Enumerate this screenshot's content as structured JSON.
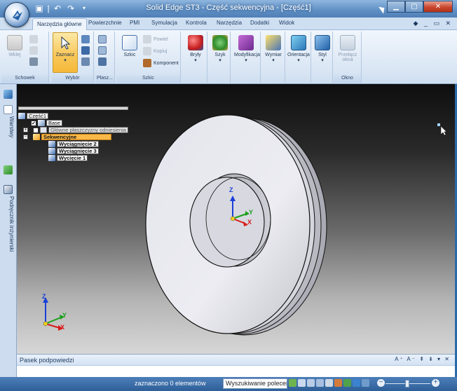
{
  "window": {
    "title": "Solid Edge ST3 - Część sekwencyjna - [Część1]"
  },
  "tabs": [
    {
      "label": "Narzędzia główne",
      "active": true
    },
    {
      "label": "Powierzchnie"
    },
    {
      "label": "PMI"
    },
    {
      "label": "Symulacja"
    },
    {
      "label": "Kontrola"
    },
    {
      "label": "Narzędzia"
    },
    {
      "label": "Dodatki"
    },
    {
      "label": "Widok"
    }
  ],
  "ribbon": {
    "schowek": {
      "label": "Schowek",
      "wklej": "Wklej"
    },
    "wybor": {
      "label": "Wybór",
      "zaznacz": "Zaznacz"
    },
    "plasz": {
      "label": "Płasz..."
    },
    "szkic": {
      "label": "Szkic",
      "szkic_btn": "Szkic",
      "powiel": "Powiel",
      "kopiuj": "Kopiuj",
      "komponent": "Komponent"
    },
    "bryly": "Bryły",
    "szyk": "Szyk",
    "modyfikacja": "Modyfikacja",
    "wymiar": "Wymiar",
    "orientacja": "Orientacja",
    "styl": "Styl",
    "okno": {
      "label": "Okno",
      "przelacz": "Przełącz",
      "okna": "okna"
    }
  },
  "left_strip": {
    "warstwy": "Warstwy",
    "podrecznik": "Podręcznik inżynierski"
  },
  "tree": {
    "root": "Część1",
    "items": [
      {
        "label": "Base"
      },
      {
        "label": "Główne płaszczyzny odniesienia"
      },
      {
        "label": "Sekwencyjne"
      },
      {
        "label": "Wyciągnięcie 2"
      },
      {
        "label": "Wyciągnięcie 3"
      },
      {
        "label": "Wycięcie 1"
      }
    ]
  },
  "triad": {
    "x": "X",
    "y": "Y",
    "z": "Z"
  },
  "prompt_bar": {
    "title": "Pasek podpowiedzi"
  },
  "status_bar": {
    "selection_text": "zaznaczono 0 elementów",
    "search_text": "Wyszukiwanie polecen"
  },
  "colors": {
    "title_bar": "#5e8fc4",
    "ribbon": "#dbe7f5",
    "highlight": "#f8b94a",
    "status_bar": "#2e5f98"
  }
}
